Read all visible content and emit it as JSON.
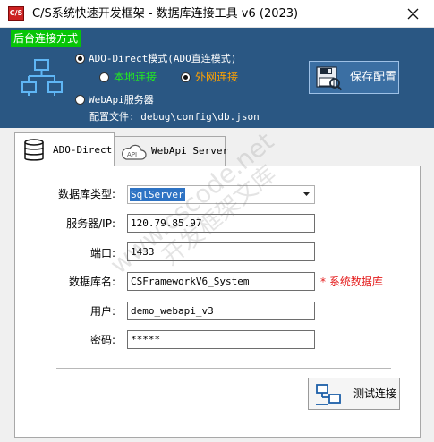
{
  "window": {
    "app_icon_text": "C/S",
    "title": "C/S系统快速开发框架 - 数据库连接工具 v6 (2023)"
  },
  "section": {
    "label": "后台连接方式"
  },
  "mode": {
    "ado_label": "ADO-Direct模式(ADO直连模式)",
    "ado_checked": true,
    "local_label": "本地连接",
    "local_checked": false,
    "remote_label": "外网连接",
    "remote_checked": true,
    "webapi_label": "WebApi服务器",
    "webapi_checked": false,
    "config_file_label": "配置文件: debug\\config\\db.json"
  },
  "toolbar": {
    "save_label": "保存配置",
    "test_label": "测试连接"
  },
  "tabs": [
    {
      "label": "ADO-Direct",
      "active": true
    },
    {
      "label": "WebApi Server",
      "active": false
    }
  ],
  "form": {
    "db_type_label": "数据库类型:",
    "db_type_value": "SqlServer",
    "server_label": "服务器/IP:",
    "server_value": "120.79.85.97",
    "port_label": "端口:",
    "port_value": "1433",
    "db_name_label": "数据库名:",
    "db_name_value": "CSFrameworkV6_System",
    "db_name_note": "* 系统数据库",
    "user_label": "用户:",
    "user_value": "demo_webapi_v3",
    "password_label": "密码:",
    "password_value": "*****"
  },
  "watermark": {
    "line1": "www.cscode.net",
    "line2": "开发框架文库"
  },
  "colors": {
    "top_panel": "#2a5783",
    "section_label": "#07c507",
    "green_text": "#22e822",
    "orange_text": "#ffa200",
    "required_text": "#e41b1b",
    "selection": "#2e73c4"
  }
}
